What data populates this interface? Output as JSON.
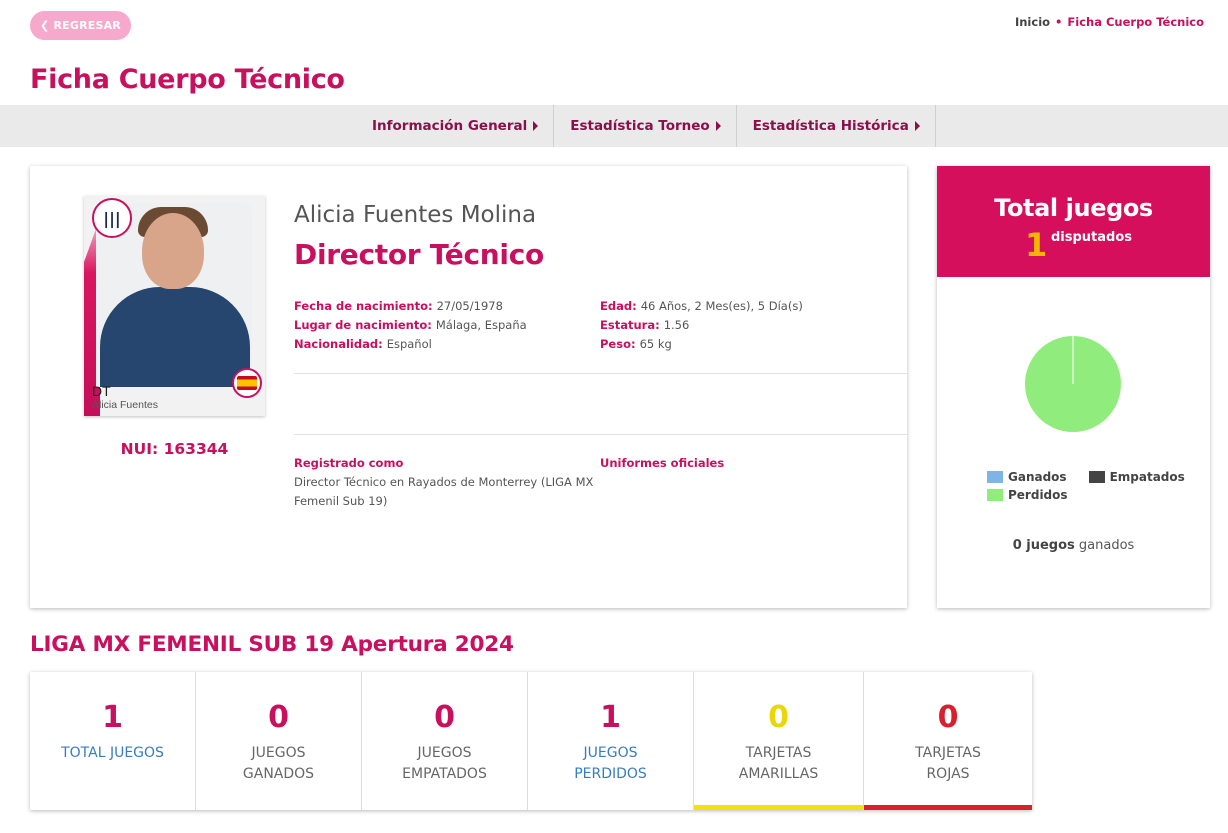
{
  "header": {
    "back_label": "REGRESAR",
    "breadcrumb": {
      "home": "Inicio",
      "separator": "•",
      "current": "Ficha Cuerpo Técnico"
    },
    "page_title": "Ficha Cuerpo Técnico"
  },
  "tabs": [
    {
      "label": "Información General"
    },
    {
      "label": "Estadística Torneo"
    },
    {
      "label": "Estadística Histórica"
    }
  ],
  "profile": {
    "photo_role": "DT",
    "photo_name": "Alicia Fuentes",
    "nui": "NUI: 163344",
    "full_name": "Alicia Fuentes Molina",
    "role": "Director Técnico",
    "details_left": [
      {
        "label": "Fecha de nacimiento:",
        "value": "27/05/1978"
      },
      {
        "label": "Lugar de nacimiento:",
        "value": "Málaga, España"
      },
      {
        "label": "Nacionalidad:",
        "value": "Español"
      }
    ],
    "details_right": [
      {
        "label": "Edad:",
        "value": "46 Años, 2 Mes(es), 5 Día(s)"
      },
      {
        "label": "Estatura:",
        "value": "1.56"
      },
      {
        "label": "Peso:",
        "value": "65 kg"
      }
    ],
    "registered_label": "Registrado como",
    "registered_value": "Director Técnico en Rayados de Monterrey (LIGA MX Femenil Sub 19)",
    "uniforms_label": "Uniformes oficiales"
  },
  "totals": {
    "title": "Total juegos",
    "count": "1",
    "subtitle": "disputados",
    "legend": [
      {
        "label": "Ganados",
        "color": "#7fb5e6"
      },
      {
        "label": "Empatados",
        "color": "#444444"
      },
      {
        "label": "Perdidos",
        "color": "#90ed7d"
      }
    ],
    "pie": {
      "won": 0,
      "drawn": 0,
      "lost": 1
    },
    "won_count": "0 juegos",
    "won_suffix": "ganados"
  },
  "season": {
    "title": "LIGA MX FEMENIL SUB 19 Apertura 2024",
    "stats": [
      {
        "value": "1",
        "line1": "TOTAL JUEGOS",
        "line2": "",
        "num_color": "#c8105e",
        "label_color": "#3a7bbf",
        "bar_color": ""
      },
      {
        "value": "0",
        "line1": "JUEGOS",
        "line2": "GANADOS",
        "num_color": "#c8105e",
        "label_color": "#666666",
        "bar_color": ""
      },
      {
        "value": "0",
        "line1": "JUEGOS",
        "line2": "EMPATADOS",
        "num_color": "#c8105e",
        "label_color": "#666666",
        "bar_color": ""
      },
      {
        "value": "1",
        "line1": "JUEGOS",
        "line2": "PERDIDOS",
        "num_color": "#c8105e",
        "label_color": "#3a7bbf",
        "bar_color": ""
      },
      {
        "value": "0",
        "line1": "TARJETAS",
        "line2": "AMARILLAS",
        "num_color": "#e8d80a",
        "label_color": "#666666",
        "bar_color": "#f2e20c"
      },
      {
        "value": "0",
        "line1": "TARJETAS",
        "line2": "ROJAS",
        "num_color": "#d8202e",
        "label_color": "#666666",
        "bar_color": "#d8202e"
      }
    ]
  },
  "colors": {
    "accent": "#c8105e",
    "header_pink": "#d60f5c",
    "back_button": "#f7a8cd"
  }
}
